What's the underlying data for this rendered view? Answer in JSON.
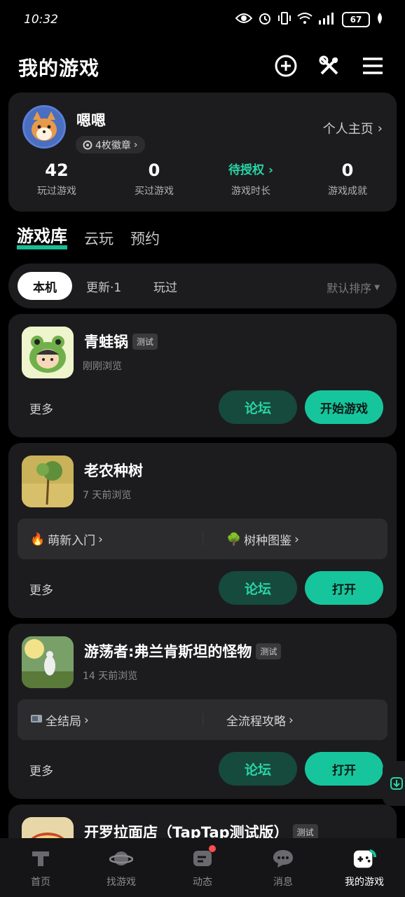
{
  "status": {
    "time": "10:32",
    "battery": "67"
  },
  "header": {
    "title": "我的游戏"
  },
  "profile": {
    "username": "嗯嗯",
    "badges": "4枚徽章",
    "homepage_link": "个人主页",
    "stats": [
      {
        "value": "42",
        "label": "玩过游戏"
      },
      {
        "value": "0",
        "label": "买过游戏"
      },
      {
        "value": "待授权",
        "label": "游戏时长"
      },
      {
        "value": "0",
        "label": "游戏成就"
      }
    ]
  },
  "library_tabs": [
    "游戏库",
    "云玩",
    "预约"
  ],
  "filters": {
    "chips": [
      "本机",
      "更新·1",
      "玩过"
    ],
    "sort": "默认排序"
  },
  "games": [
    {
      "name": "青蛙锅",
      "tag": "测试",
      "browsed": "刚刚浏览",
      "more": "更多",
      "forum": "论坛",
      "action": "开始游戏"
    },
    {
      "name": "老农种树",
      "browsed": "7 天前浏览",
      "links": [
        "萌新入门",
        "树种图鉴"
      ],
      "more": "更多",
      "forum": "论坛",
      "action": "打开"
    },
    {
      "name": "游荡者:弗兰肯斯坦的怪物",
      "tag": "测试",
      "browsed": "14 天前浏览",
      "links": [
        "全结局",
        "全流程攻略"
      ],
      "more": "更多",
      "forum": "论坛",
      "action": "打开"
    },
    {
      "name": "开罗拉面店（TapTap测试版）",
      "tag": "测试"
    }
  ],
  "bottom_nav": [
    "首页",
    "找游戏",
    "动态",
    "消息",
    "我的游戏"
  ],
  "colors": {
    "accent": "#17c59c",
    "accent_text": "#2ad3a5",
    "card_bg": "#1c1c1e",
    "page_bg": "#000000"
  }
}
